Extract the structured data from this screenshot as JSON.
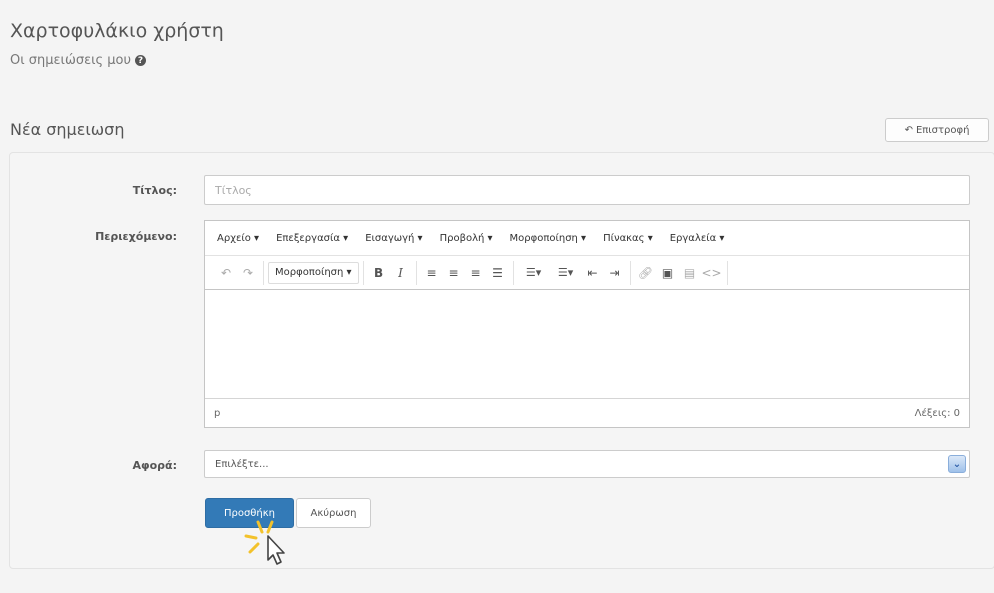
{
  "header": {
    "title": "Χαρτοφυλάκιο χρήστη",
    "subtitle": "Οι σημειώσεις μου",
    "back_label": "Επιστροφή"
  },
  "section": {
    "title": "Νέα σημειωση"
  },
  "form": {
    "title_label": "Τίτλος:",
    "title_placeholder": "Τίτλος",
    "title_value": "",
    "content_label": "Περιεχόμενο:",
    "concerns_label": "Αφορά:",
    "concerns_selected": "Επιλέξτε...",
    "submit_label": "Προσθήκη",
    "cancel_label": "Ακύρωση"
  },
  "editor": {
    "menus": [
      "Αρχείο ▾",
      "Επεξεργασία ▾",
      "Εισαγωγή ▾",
      "Προβολή ▾",
      "Μορφοποίηση ▾",
      "Πίνακας ▾",
      "Εργαλεία ▾"
    ],
    "format_dropdown": "Μορφοποίηση ▾",
    "status_path": "p",
    "word_count": "Λέξεις: 0"
  },
  "colors": {
    "primary_button": "#337ab7",
    "panel_background": "#f5f5f5",
    "page_background": "#f4f4f4"
  },
  "icons": [
    "info-icon",
    "reply-icon",
    "undo-icon",
    "redo-icon",
    "bold-icon",
    "italic-icon",
    "align-left-icon",
    "align-center-icon",
    "align-right-icon",
    "align-justify-icon",
    "bullet-list-icon",
    "numbered-list-icon",
    "outdent-icon",
    "indent-icon",
    "link-icon",
    "image-icon",
    "media-icon",
    "code-icon",
    "dropdown-arrow-icon",
    "mouse-cursor-icon"
  ]
}
